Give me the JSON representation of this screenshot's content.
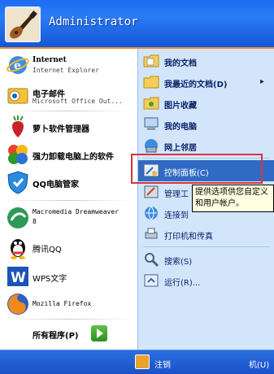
{
  "header": {
    "username": "Administrator"
  },
  "left_items": [
    {
      "title": "Internet",
      "sub": "Internet Explorer"
    },
    {
      "title": "电子邮件",
      "sub": "Microsoft Office Out..."
    },
    {
      "label": "萝卜软件管理器"
    },
    {
      "label": "强力卸载电脑上的软件"
    },
    {
      "label": "QQ电脑管家"
    },
    {
      "label": "Macromedia Dreamweaver 8"
    },
    {
      "label": "腾讯QQ"
    },
    {
      "label": "WPS文字"
    },
    {
      "label": "Mozilla Firefox"
    }
  ],
  "dw": {
    "line1": "Macromedia Dreamweaver",
    "line2": "8"
  },
  "all_programs": "所有程序(P)",
  "right_items": [
    {
      "label": "我的文档"
    },
    {
      "label": "我最近的文档(D)",
      "arrow": "▸"
    },
    {
      "label": "图片收藏"
    },
    {
      "label": "我的电脑"
    },
    {
      "label": "网上邻居"
    },
    {
      "label": "控制面板(C)"
    },
    {
      "label": "管理工"
    },
    {
      "label": "连接到"
    },
    {
      "label": "打印机和传真"
    },
    {
      "label": "搜索(S)"
    },
    {
      "label": "运行(R)..."
    }
  ],
  "tooltip": {
    "line1": "提供选项供您自定义",
    "line2": "和用户帐户。"
  },
  "bottom": {
    "logoff": "注销",
    "shutdown": "机(U)"
  },
  "colors": {
    "accent": "#316ac5",
    "highlight": "#d9343a",
    "header": "#1d6cf2"
  }
}
